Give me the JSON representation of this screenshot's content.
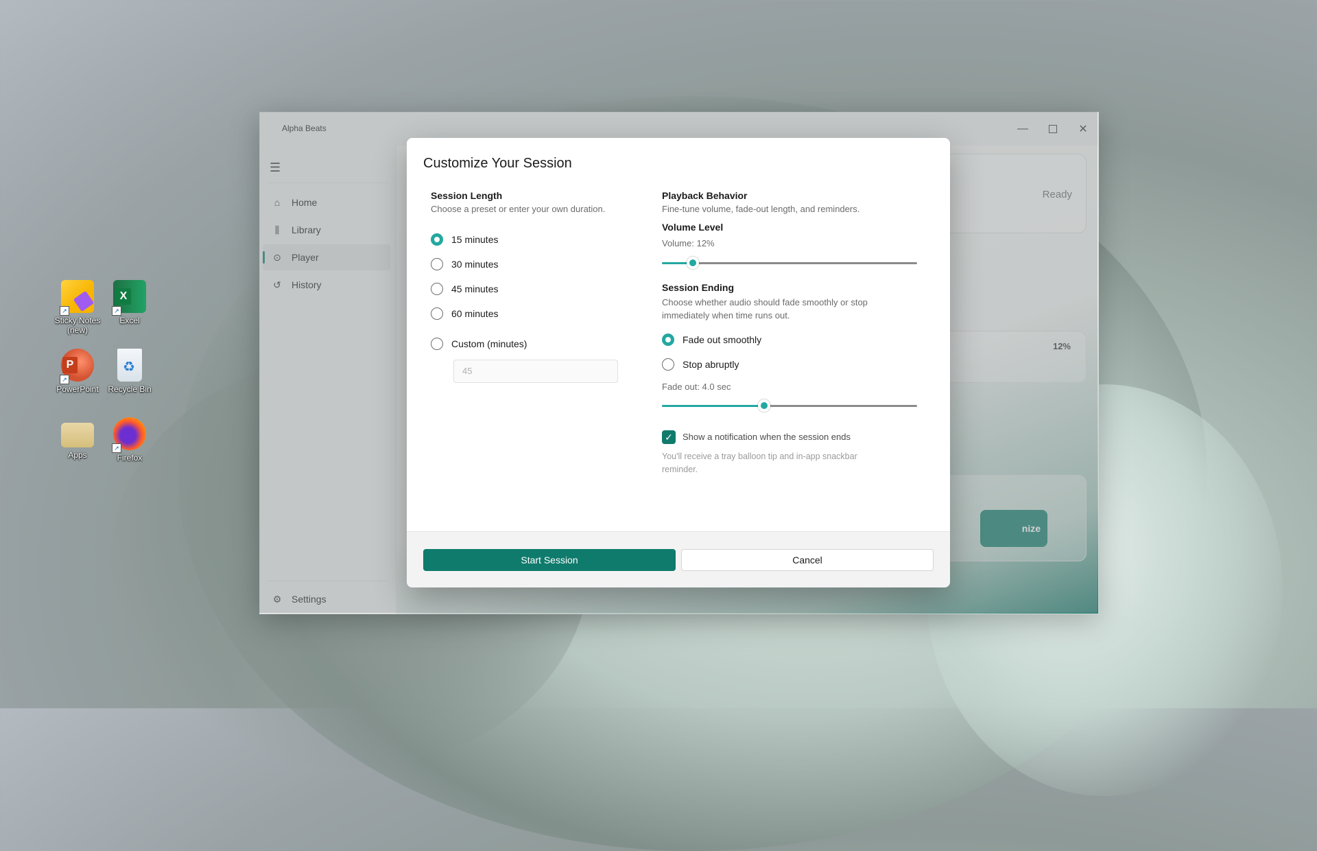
{
  "desktop": {
    "icons": [
      {
        "label": "Sticky Notes (new)",
        "icon": "sticky-notes-icon"
      },
      {
        "label": "Excel",
        "icon": "excel-icon"
      },
      {
        "label": "PowerPoint",
        "icon": "powerpoint-icon"
      },
      {
        "label": "Recycle Bin",
        "icon": "recycle-bin-icon"
      },
      {
        "label": "Apps",
        "icon": "folder-icon"
      },
      {
        "label": "Firefox",
        "icon": "firefox-icon"
      }
    ]
  },
  "app": {
    "title": "Alpha Beats",
    "nav": [
      {
        "label": "Home",
        "icon": "home-icon"
      },
      {
        "label": "Library",
        "icon": "library-icon"
      },
      {
        "label": "Player",
        "icon": "play-circle-icon",
        "active": true
      },
      {
        "label": "History",
        "icon": "history-icon"
      }
    ],
    "settings_label": "Settings",
    "background": {
      "status": "Ready",
      "volume_pct": "12%",
      "button_partial": "nize"
    }
  },
  "dialog": {
    "title": "Customize Your Session",
    "session_length": {
      "heading": "Session Length",
      "subtitle": "Choose a preset or enter your own duration.",
      "options": [
        "15 minutes",
        "30 minutes",
        "45 minutes",
        "60 minutes"
      ],
      "selected_index": 0,
      "custom_label": "Custom (minutes)",
      "custom_placeholder": "45"
    },
    "playback": {
      "heading": "Playback Behavior",
      "subtitle": "Fine-tune volume, fade-out length, and reminders.",
      "volume_heading": "Volume Level",
      "volume_text": "Volume: 12%",
      "volume_fraction": 0.12,
      "ending_heading": "Session Ending",
      "ending_subtitle": "Choose whether audio should fade smoothly or stop immediately when time runs out.",
      "ending_options": [
        "Fade out smoothly",
        "Stop abruptly"
      ],
      "ending_selected_index": 0,
      "fade_text": "Fade out: 4.0 sec",
      "fade_fraction": 0.4,
      "notify_label": "Show a notification when the session ends",
      "notify_checked": true,
      "notify_hint": "You'll receive a tray balloon tip and in-app snackbar reminder."
    },
    "start_label": "Start Session",
    "cancel_label": "Cancel"
  },
  "colors": {
    "accent": "#0f7b6c",
    "accent_light": "#23a8a0"
  }
}
